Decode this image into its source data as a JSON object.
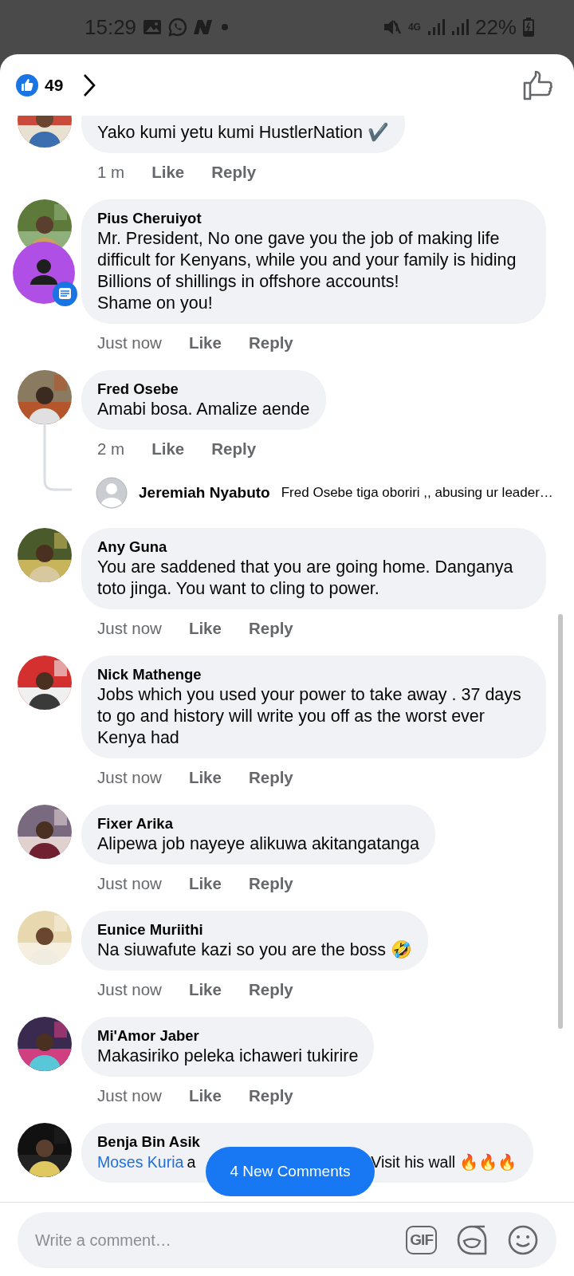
{
  "status_bar": {
    "time": "15:29",
    "network": "4G",
    "battery": "22%"
  },
  "header": {
    "reaction_count": "49"
  },
  "comments": [
    {
      "text": "Yako kumi yetu kumi HustlerNation ✔️",
      "time": "1 m",
      "like_label": "Like",
      "reply_label": "Reply"
    },
    {
      "author": "Pius Cheruiyot",
      "text": "Mr. President, No one gave you the job of making life difficult for Kenyans, while you and your family is hiding Billions of shillings in offshore accounts!\nShame on you!",
      "time": "Just now",
      "like_label": "Like",
      "reply_label": "Reply"
    },
    {
      "author": "Fred Osebe",
      "text": "Amabi bosa. Amalize aende",
      "time": "2 m",
      "like_label": "Like",
      "reply_label": "Reply",
      "reply_preview": {
        "author": "Jeremiah Nyabuto",
        "text": "Fred Osebe tiga oboriri ,, abusing ur leader…"
      }
    },
    {
      "author": "Any Guna",
      "text": "You are saddened that you are going home. Danganya toto jinga. You want to cling to power.",
      "time": "Just now",
      "like_label": "Like",
      "reply_label": "Reply"
    },
    {
      "author": "Nick Mathenge",
      "text": "Jobs which you used your power to take away . 37 days to go and history will write you off as the worst ever Kenya had",
      "time": "Just now",
      "like_label": "Like",
      "reply_label": "Reply"
    },
    {
      "author": "Fixer Arika",
      "text": "Alipewa job nayeye alikuwa akitangatanga",
      "time": "Just now",
      "like_label": "Like",
      "reply_label": "Reply"
    },
    {
      "author": "Eunice Muriithi",
      "text": "Na siuwafute kazi so you are the boss 🤣",
      "time": "Just now",
      "like_label": "Like",
      "reply_label": "Reply"
    },
    {
      "author": "Mi'Amor Jaber",
      "text": "Makasiriko peleka ichaweri  tukirire",
      "time": "Just now",
      "like_label": "Like",
      "reply_label": "Reply"
    },
    {
      "author": "Benja Bin Asik",
      "mention": "Moses Kuria",
      "text": "a",
      "text_after_overlay": "Visit his wall 🔥🔥🔥"
    }
  ],
  "new_comments_button": "4 New Comments",
  "composer": {
    "placeholder": "Write a comment…",
    "gif_label": "GIF"
  }
}
